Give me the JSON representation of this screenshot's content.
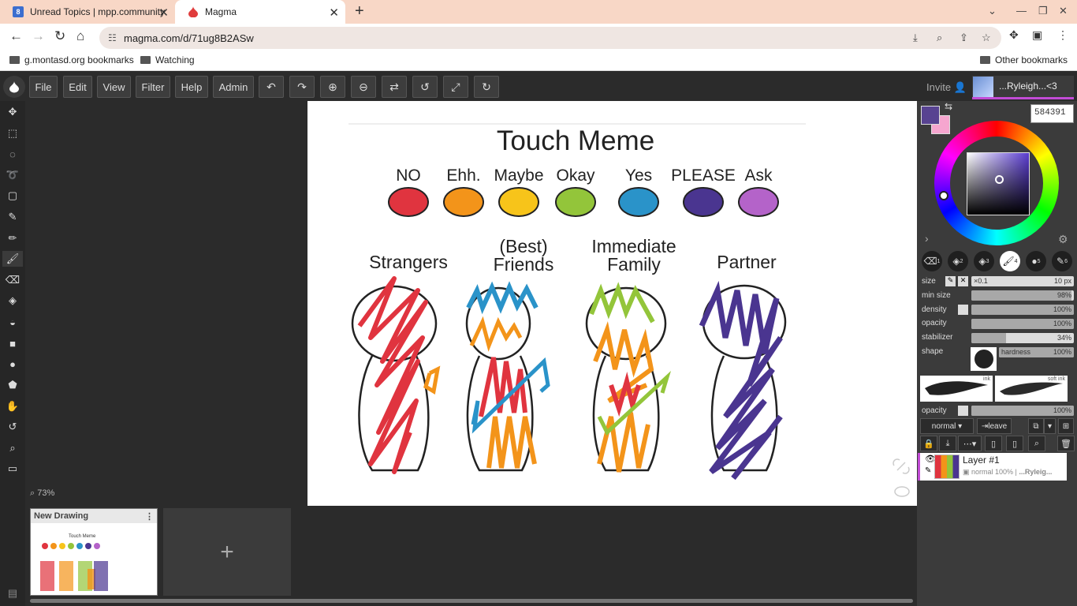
{
  "browser": {
    "tabs": [
      {
        "label": "Unread Topics | mpp.community",
        "favicon": "mpp"
      },
      {
        "label": "Magma",
        "favicon": "magma-drop"
      }
    ],
    "url": "magma.com/d/71ug8B2ASw",
    "bookmarks": [
      "g.montasd.org bookmarks",
      "Watching",
      "Other bookmarks"
    ]
  },
  "app": {
    "menus": [
      "File",
      "Edit",
      "View",
      "Filter",
      "Help",
      "Admin"
    ],
    "invite_label": "Invite",
    "user_name": "...Ryleigh...<3",
    "zoom_label": "73%",
    "drawing_title": "New Drawing"
  },
  "artwork": {
    "title": "Touch Meme",
    "levels": [
      {
        "label": "NO",
        "color": "#e0343f"
      },
      {
        "label": "Ehh.",
        "color": "#f3941a"
      },
      {
        "label": "Maybe",
        "color": "#f7c41a"
      },
      {
        "label": "Okay",
        "color": "#93c53a"
      },
      {
        "label": "Yes",
        "color": "#2a93c9"
      },
      {
        "label": "PLEASE",
        "color": "#4a3590"
      },
      {
        "label": "Ask",
        "color": "#b463c9"
      }
    ],
    "groups": [
      "Strangers",
      "(Best) Friends",
      "Immediate Family",
      "Partner"
    ]
  },
  "panel": {
    "hex": "584391",
    "primary_color": "#584391",
    "secondary_color": "#f6a6cf",
    "brush_slots": [
      "1",
      "2",
      "3",
      "4",
      "5",
      "6"
    ],
    "size_label": "size",
    "size_mult": "×0.1",
    "size_value": "10 px",
    "min_size_label": "min size",
    "min_size_value": "98%",
    "density_label": "density",
    "density_value": "100%",
    "opacity_label": "opacity",
    "opacity_value": "100%",
    "stabilizer_label": "stabilizer",
    "stabilizer_value": "34%",
    "shape_label": "shape",
    "hardness_label": "hardness",
    "hardness_value": "100%",
    "presets": [
      "ink",
      "soft ink"
    ],
    "layer_opacity_label": "opacity",
    "layer_opacity_value": "100%",
    "blend_mode": "normal",
    "leave_label": "leave",
    "layer_name": "Layer #1",
    "layer_info": "normal 100% |",
    "layer_owner": "...Ryleig..."
  }
}
